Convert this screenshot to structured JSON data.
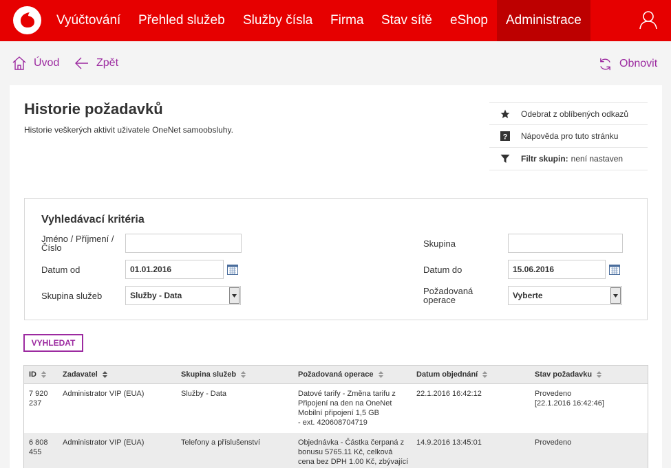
{
  "nav": {
    "items": [
      {
        "label": "Vyúčtování"
      },
      {
        "label": "Přehled služeb"
      },
      {
        "label": "Služby čísla"
      },
      {
        "label": "Firma"
      },
      {
        "label": "Stav sítě"
      },
      {
        "label": "eShop"
      },
      {
        "label": "Administrace"
      }
    ]
  },
  "breadcrumb": {
    "home": "Úvod",
    "back": "Zpět",
    "refresh": "Obnovit"
  },
  "page": {
    "title": "Historie požadavků",
    "subtitle": "Historie veškerých aktivit uživatele OneNet samoobsluhy."
  },
  "side_links": {
    "favorite": "Odebrat z oblíbených odkazů",
    "help": "Nápověda pro tuto stránku",
    "filter_label": "Filtr skupin:",
    "filter_value": "není nastaven"
  },
  "search": {
    "title": "Vyhledávací kritéria",
    "name_label_1": "Jméno / Příjmení /",
    "name_label_2": "Číslo",
    "name_value": "",
    "group_label": "Skupina",
    "group_value": "",
    "date_from_label": "Datum od",
    "date_from_value": "01.01.2016",
    "date_to_label": "Datum do",
    "date_to_value": "15.06.2016",
    "service_group_label": "Skupina služeb",
    "service_group_value": "Služby - Data",
    "operation_label_1": "Požadovaná",
    "operation_label_2": "operace",
    "operation_value": "Vyberte",
    "button": "VYHLEDAT"
  },
  "table": {
    "columns": [
      "ID",
      "Zadavatel",
      "Skupina služeb",
      "Požadovaná operace",
      "Datum objednání",
      "Stav požadavku"
    ],
    "rows": [
      {
        "id_1": "7 920",
        "id_2": "237",
        "submitter": "Administrator VIP (EUA)",
        "group": "Služby - Data",
        "op_1": "Datové tarify - Změna tarifu z",
        "op_2": "Připojení na den na OneNet",
        "op_3": "Mobilní připojení 1,5 GB",
        "op_4": "- ext. 420608704719",
        "date": "22.1.2016 16:42:12",
        "status_1": "Provedeno",
        "status_2": "[22.1.2016 16:42:46]"
      },
      {
        "id_1": "6 808",
        "id_2": "455",
        "submitter": "Administrator VIP (EUA)",
        "group": "Telefony a příslušenství",
        "op_1": "Objednávka - Částka čerpaná z",
        "op_2": "bonusu 5765.11 Kč, celková",
        "op_3": "cena bez DPH 1.00 Kč, zbývající",
        "date": "14.9.2016 13:45:01",
        "status_1": "Provedeno"
      }
    ]
  },
  "colors": {
    "brand_red": "#e60000",
    "active_nav": "#bd0000",
    "accent_purple": "#9c2aa0"
  }
}
